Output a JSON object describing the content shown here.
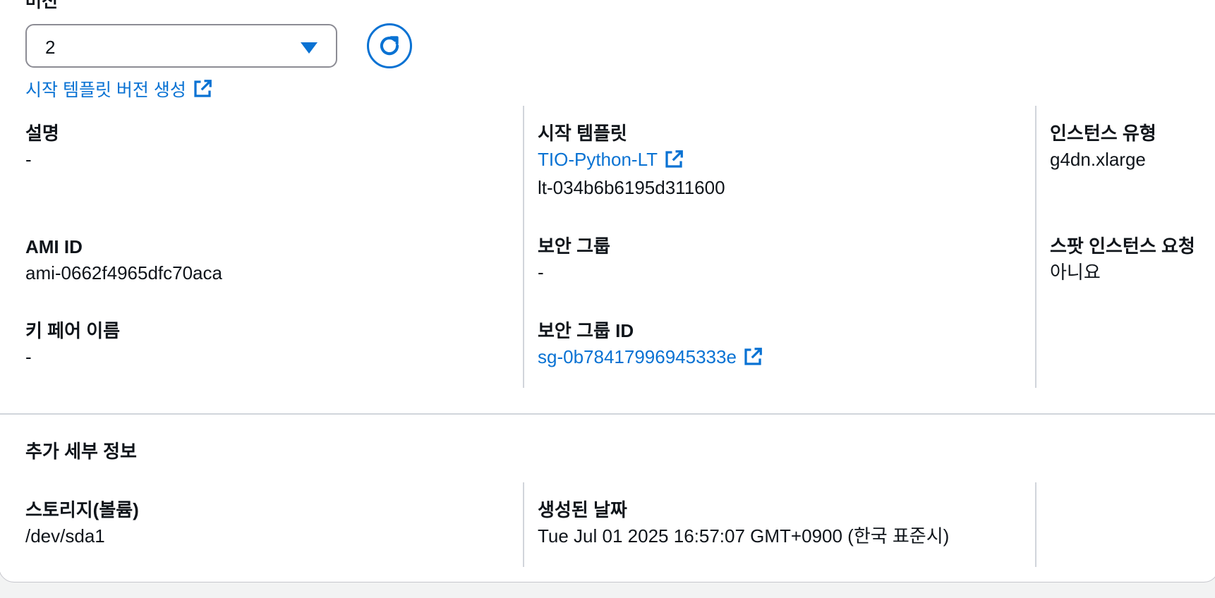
{
  "version": {
    "label_partial": "버전",
    "selected": "2",
    "create_link": "시작 템플릿 버전 생성"
  },
  "details": {
    "description": {
      "label": "설명",
      "value": "-"
    },
    "launch_template": {
      "label": "시작 템플릿",
      "name": "TIO-Python-LT",
      "id": "lt-034b6b6195d311600"
    },
    "instance_type": {
      "label": "인스턴스 유형",
      "value": "g4dn.xlarge"
    },
    "ami_id": {
      "label": "AMI ID",
      "value": "ami-0662f4965dfc70aca"
    },
    "security_group": {
      "label": "보안 그룹",
      "value": "-"
    },
    "spot_request": {
      "label": "스팟 인스턴스 요청",
      "value": "아니요"
    },
    "key_pair": {
      "label": "키 페어 이름",
      "value": "-"
    },
    "security_group_id": {
      "label": "보안 그룹 ID",
      "value": "sg-0b78417996945333e"
    }
  },
  "additional": {
    "title": "추가 세부 정보",
    "storage": {
      "label": "스토리지(볼륨)",
      "value": "/dev/sda1"
    },
    "created": {
      "label": "생성된 날짜",
      "value": "Tue Jul 01 2025 16:57:07 GMT+0900 (한국 표준시)"
    }
  },
  "colors": {
    "link": "#0972d3",
    "text": "#0f141a",
    "divider": "#d1d5db"
  },
  "icons": [
    "caret-down-icon",
    "refresh-icon",
    "external-link-icon"
  ]
}
